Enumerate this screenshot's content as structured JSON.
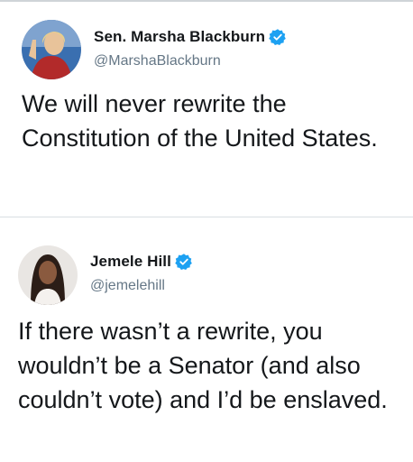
{
  "tweets": [
    {
      "display_name": "Sen. Marsha Blackburn",
      "handle": "@MarshaBlackburn",
      "verified": true,
      "avatar": "marsha-blackburn-avatar",
      "text": "We will never rewrite the Constitution of the United States."
    },
    {
      "display_name": "Jemele Hill",
      "handle": "@jemelehill",
      "verified": true,
      "avatar": "jemele-hill-avatar",
      "text": "If there wasn’t a rewrite, you wouldn’t be a Senator (and also couldn’t vote) and I’d be enslaved."
    }
  ],
  "colors": {
    "verified_badge": "#1da1f2",
    "handle_text": "#657786",
    "body_text": "#14171a",
    "divider": "#d9dee2"
  },
  "icons": {
    "verified": "verified-badge-icon"
  }
}
